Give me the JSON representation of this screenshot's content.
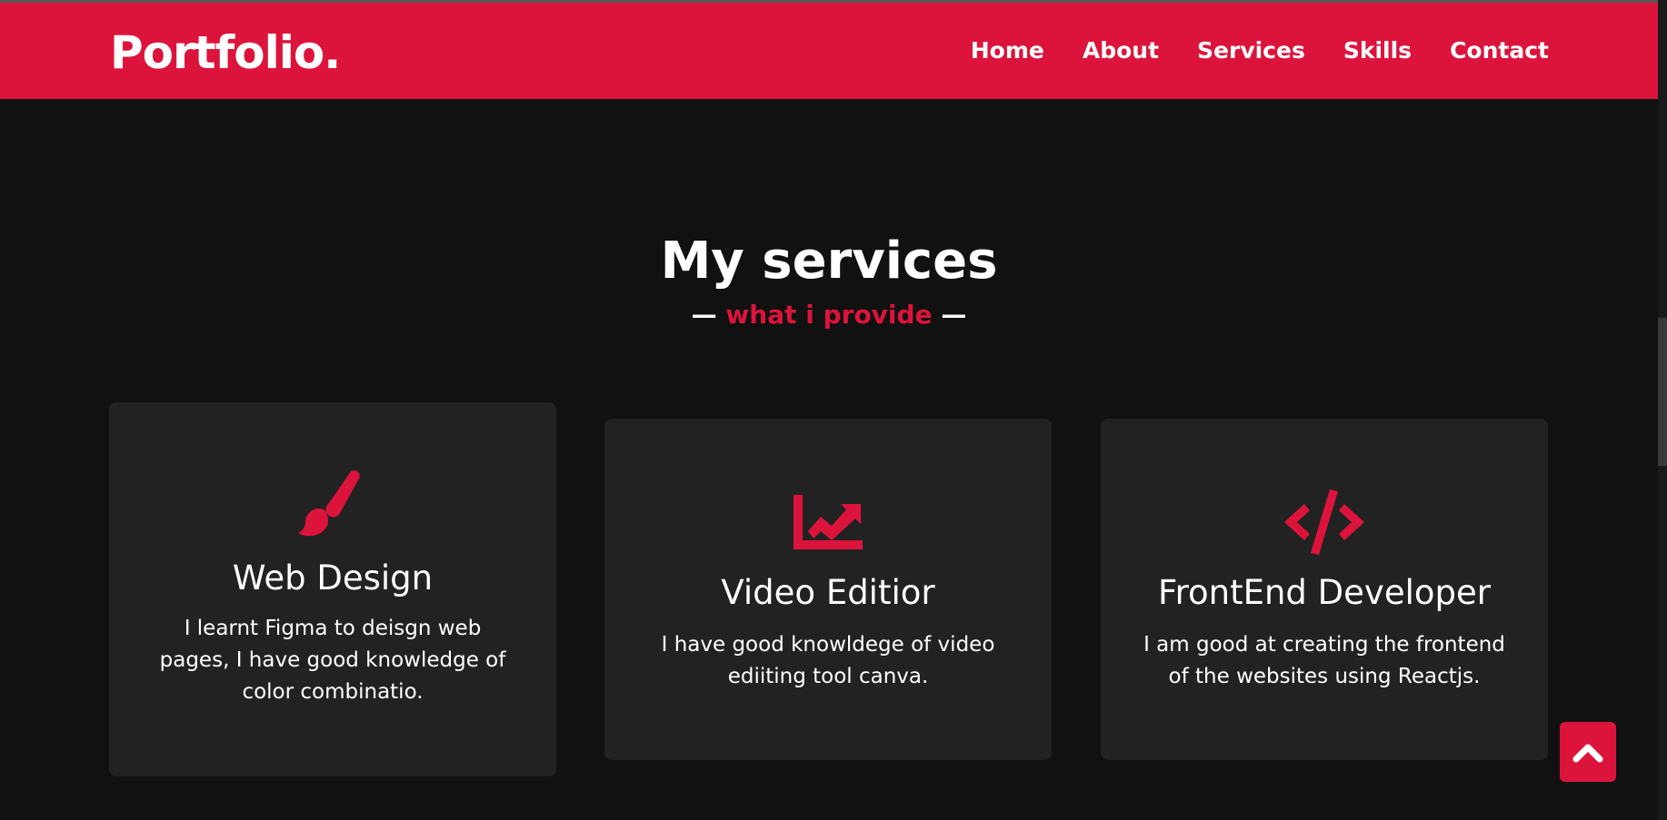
{
  "header": {
    "logo": "Portfolio.",
    "nav": [
      {
        "label": "Home"
      },
      {
        "label": "About"
      },
      {
        "label": "Services"
      },
      {
        "label": "Skills"
      },
      {
        "label": "Contact"
      }
    ]
  },
  "services": {
    "title": "My services",
    "subtitle_dash_left": "—",
    "subtitle": "what i provide",
    "subtitle_dash_right": "—",
    "cards": [
      {
        "icon": "paint-brush-icon",
        "title": "Web Design",
        "text": "I learnt Figma to deisgn web pages, I have good knowledge of color combinatio."
      },
      {
        "icon": "chart-line-icon",
        "title": "Video Editior",
        "text": "I have good knowldege of video ediiting tool canva."
      },
      {
        "icon": "code-icon",
        "title": "FrontEnd Developer",
        "text": "I am good at creating the frontend of the websites using Reactjs."
      }
    ]
  },
  "colors": {
    "accent": "#dc143c",
    "background": "#111111",
    "card": "#222222",
    "text": "#ffffff"
  },
  "scroll_to_top": {
    "icon": "chevron-up-icon"
  }
}
